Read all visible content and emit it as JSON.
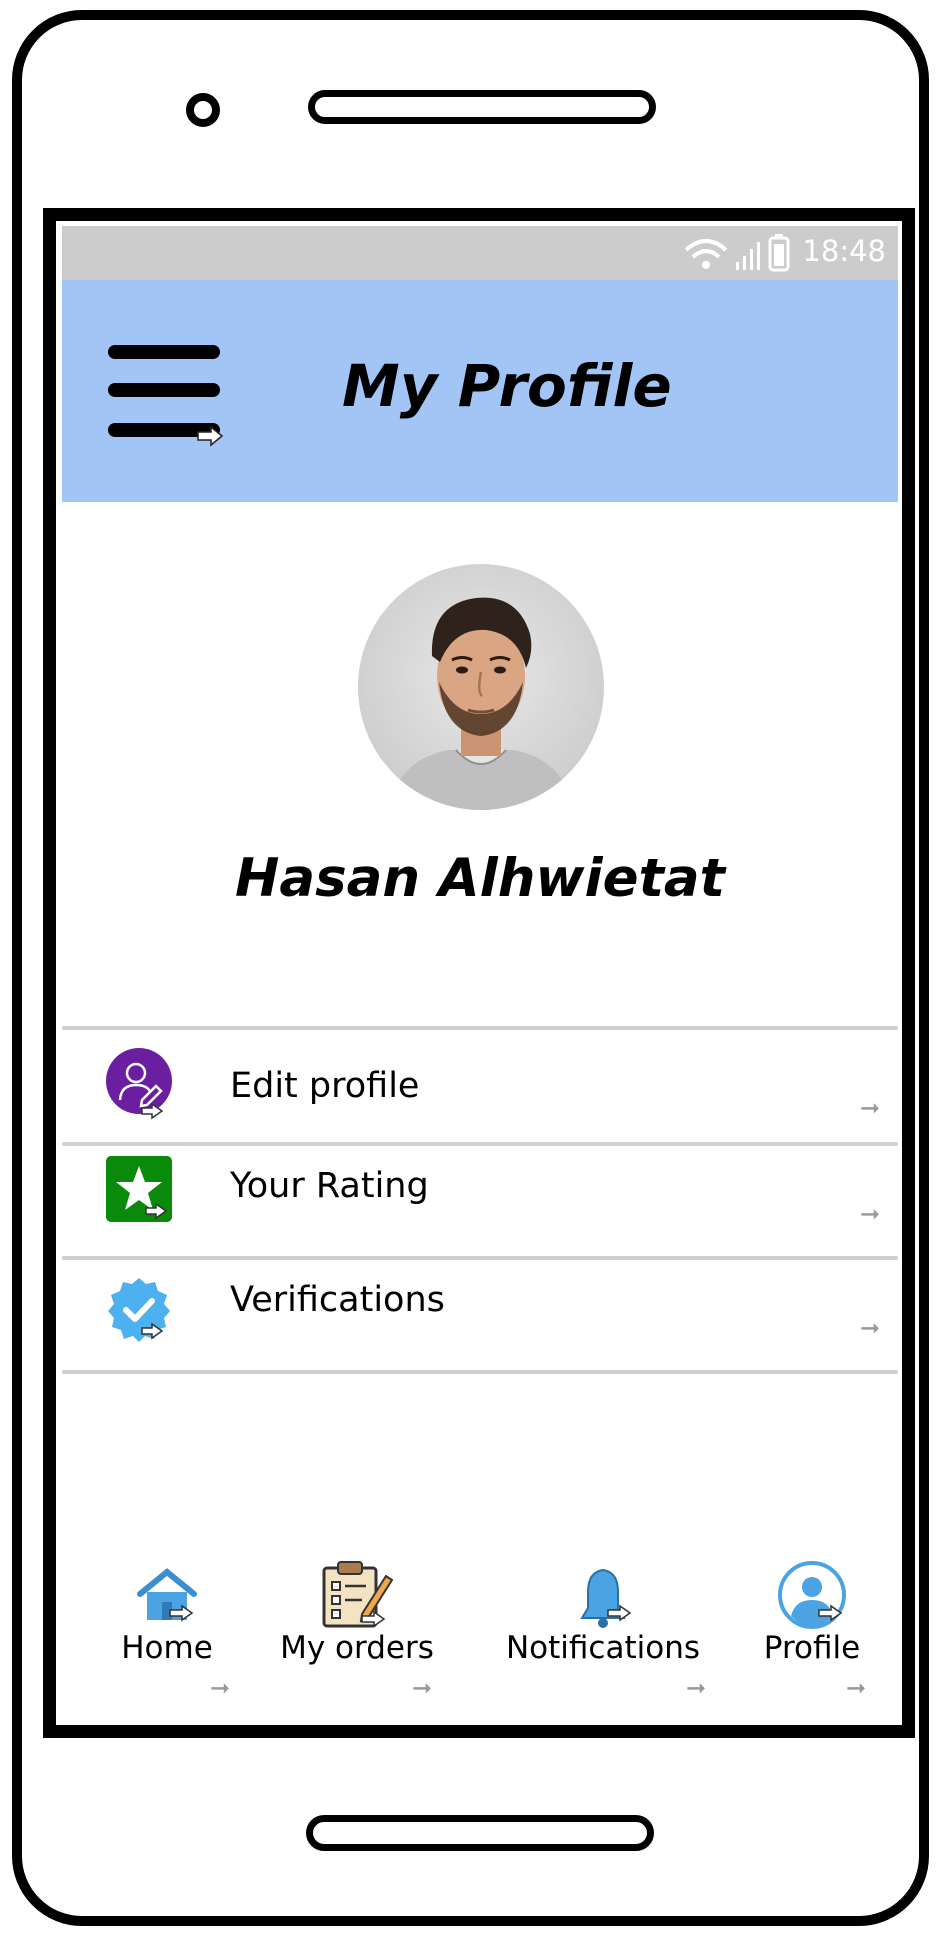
{
  "status_bar": {
    "time": "18:48"
  },
  "header": {
    "title": "My Profile",
    "background": "#a3c5f6"
  },
  "profile": {
    "name": "Hasan Alhwietat"
  },
  "menu": [
    {
      "label": "Edit profile",
      "icon": "edit-user-icon",
      "color": "#6a1fa0"
    },
    {
      "label": "Your Rating",
      "icon": "star-icon",
      "color": "#0a8a0a"
    },
    {
      "label": "Verifications",
      "icon": "verified-badge-icon",
      "color": "#4db0ef"
    }
  ],
  "bottom_nav": [
    {
      "label": "Home",
      "icon": "home-icon"
    },
    {
      "label": "My orders",
      "icon": "clipboard-icon"
    },
    {
      "label": "Notifications",
      "icon": "bell-icon"
    },
    {
      "label": "Profile",
      "icon": "user-circle-icon"
    }
  ]
}
